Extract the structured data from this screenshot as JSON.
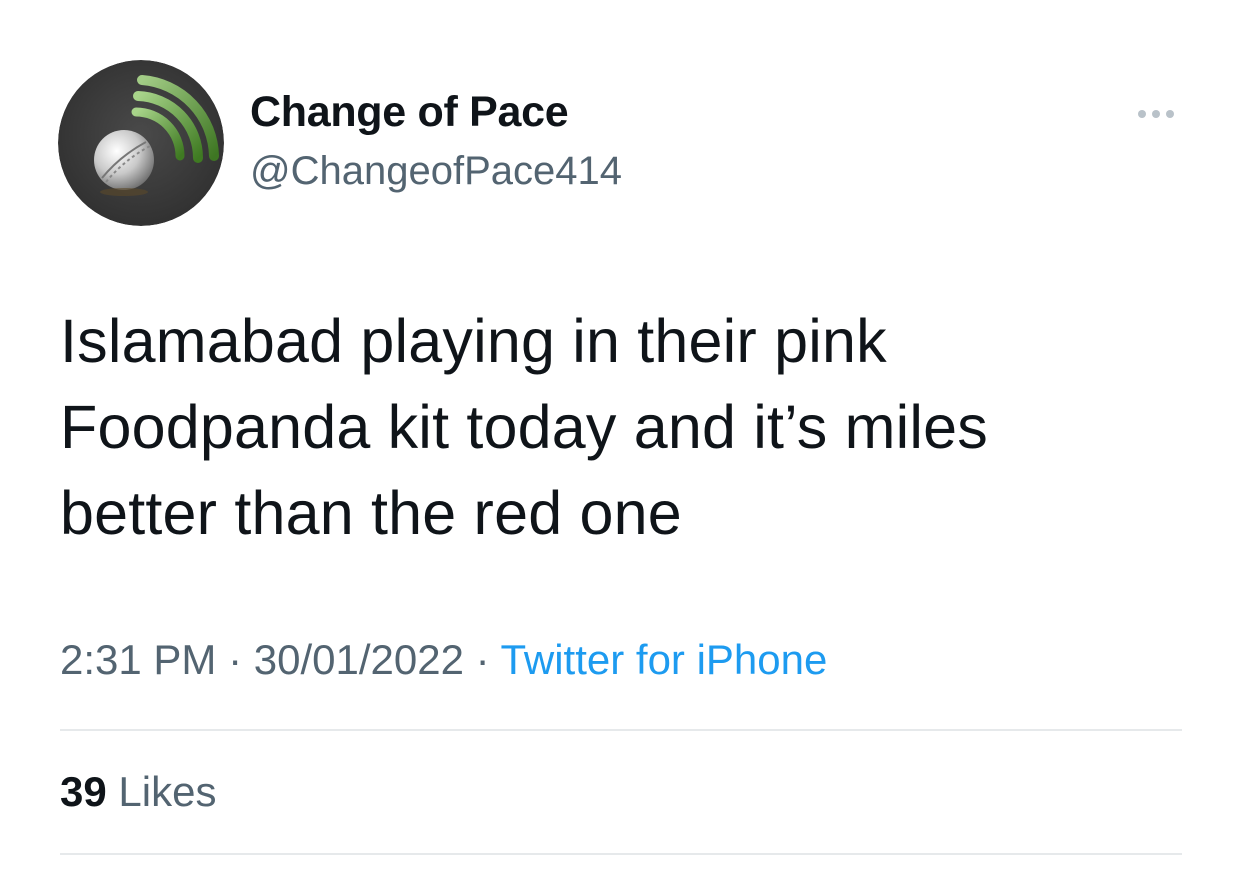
{
  "tweet": {
    "display_name": "Change of Pace",
    "handle": "@ChangeofPace414",
    "avatar_icon": "cricket-ball-signal-icon",
    "more_icon": "more-options-icon",
    "text_lines": [
      "Islamabad playing in their pink",
      "Foodpanda kit today and it’s miles",
      "better than the red one"
    ],
    "time": "2:31 PM",
    "separator": " · ",
    "date": "30/01/2022",
    "source": "Twitter for iPhone",
    "likes_count": "39",
    "likes_label": "Likes"
  },
  "colors": {
    "text_primary": "#0f1419",
    "text_secondary": "#536471",
    "link_blue": "#1d9bf0",
    "divider": "#e6e9eb",
    "avatar_background": "#3e3e3e",
    "avatar_signal_green": "#5f9a3c"
  }
}
